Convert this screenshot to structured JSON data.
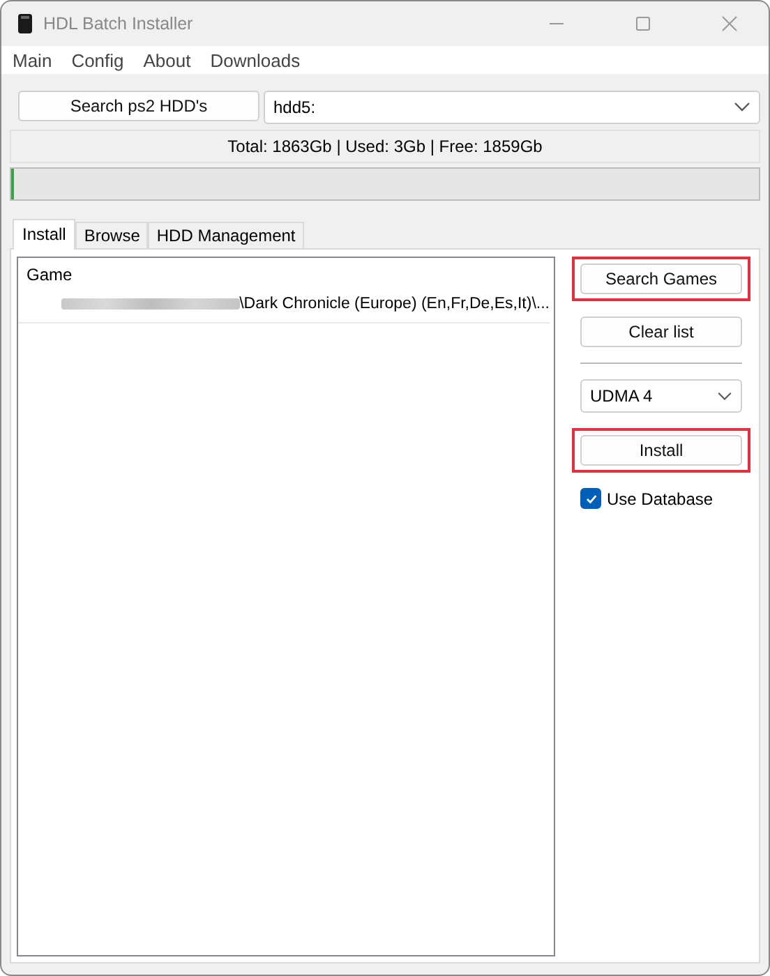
{
  "window": {
    "title": "HDL Batch Installer"
  },
  "menu": [
    "Main",
    "Config",
    "About",
    "Downloads"
  ],
  "search_hdd_button": "Search ps2 HDD's",
  "drive_select": {
    "value": "hdd5:"
  },
  "disk_info": "Total: 1863Gb | Used: 3Gb | Free: 1859Gb",
  "progress": {
    "level": 0.004
  },
  "tabs": [
    {
      "label": "Install",
      "selected": true
    },
    {
      "label": "Browse",
      "selected": false
    },
    {
      "label": "HDD Management",
      "selected": false
    }
  ],
  "games_list": {
    "column": "Game",
    "rows": [
      {
        "path": "\\Dark Chronicle (Europe) (En,Fr,De,Es,It)\\...",
        "redacted": true
      }
    ]
  },
  "side_buttons": [
    {
      "kind": "button",
      "label": "Search Games",
      "highlighted": true
    },
    {
      "kind": "button",
      "label": "Clear list",
      "highlighted": false
    },
    {
      "kind": "select",
      "value": "UDMA 4",
      "highlighted": false
    },
    {
      "kind": "button",
      "label": "Install",
      "highlighted": true
    },
    {
      "kind": "checkbox",
      "label": "Use Database",
      "checked": true,
      "highlighted": false
    }
  ]
}
